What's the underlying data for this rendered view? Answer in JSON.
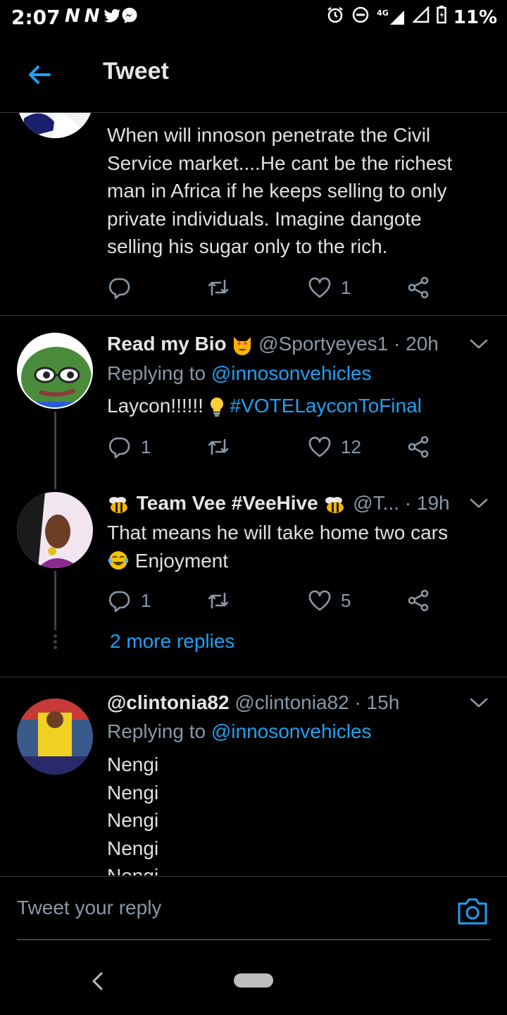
{
  "status_bar": {
    "time": "2:07",
    "left_icons": [
      "n-icon",
      "n-icon",
      "twitter-bird-icon",
      "messenger-icon"
    ],
    "right_icons": [
      "alarm-icon",
      "do-not-disturb-icon",
      "4g-signal-icon",
      "signal-icon",
      "battery-icon"
    ],
    "network": "4G",
    "battery": "11%"
  },
  "header": {
    "title": "Tweet"
  },
  "tweets": [
    {
      "text_lines": [
        "When will innoson penetrate the Civil",
        "Service market....He cant be the richest",
        "man in Africa if he keeps selling to only",
        "private individuals. Imagine dangote",
        "selling his sugar only to the rich."
      ],
      "replies": "",
      "likes": "1"
    },
    {
      "name": "Read my Bio",
      "name_emoji": "heart-eyes-cat-emoji",
      "handle": "@Sportyeyes1",
      "time": "· 20h",
      "replying_prefix": "Replying to",
      "replying_to": "@innosonvehicles",
      "text": "Laycon!!!!!!",
      "hashtag": "#VOTELayconToFinal",
      "replies": "1",
      "likes": "12"
    },
    {
      "name": "Team Vee #VeeHive",
      "handle": "@T...",
      "time": "· 19h",
      "text_line1": "That means he will take home two cars",
      "text_line2": "Enjoyment",
      "replies": "1",
      "likes": "5",
      "more_replies": "2 more replies"
    },
    {
      "name": "@clintonia82",
      "handle": "@clintonia82",
      "time": "· 15h",
      "replying_prefix": "Replying to",
      "replying_to": "@innosonvehicles",
      "text_lines": [
        "Nengi",
        "Nengi",
        "Nengi",
        "Nengi",
        "Nengi"
      ]
    }
  ],
  "reply_bar": {
    "placeholder": "Tweet your reply"
  },
  "colors": {
    "background": "#000000",
    "accent": "#1da1f2",
    "muted": "#8899a6",
    "divider": "#2f3336"
  }
}
